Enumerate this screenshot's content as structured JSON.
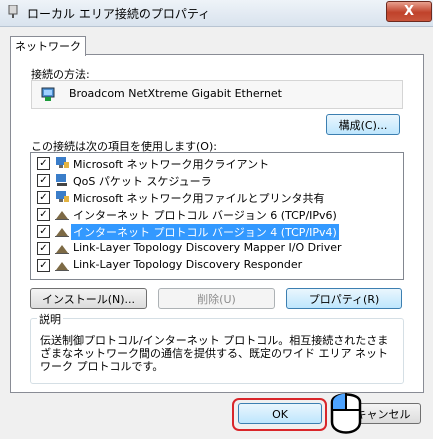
{
  "window": {
    "title": "ローカル エリア接続のプロパティ",
    "close_glyph": "X"
  },
  "tabs": [
    {
      "label": "ネットワーク"
    }
  ],
  "connect_using": {
    "label": "接続の方法:",
    "adapter": "Broadcom NetXtreme Gigabit Ethernet",
    "configure_button": "構成(C)..."
  },
  "items_section": {
    "label": "この接続は次の項目を使用します(O):",
    "items": [
      {
        "label": "Microsoft ネットワーク用クライアント",
        "checked": true,
        "icon": "network-client-icon"
      },
      {
        "label": "QoS パケット スケジューラ",
        "checked": true,
        "icon": "service-icon"
      },
      {
        "label": "Microsoft ネットワーク用ファイルとプリンタ共有",
        "checked": true,
        "icon": "network-client-icon"
      },
      {
        "label": "インターネット プロトコル バージョン 6 (TCP/IPv6)",
        "checked": true,
        "icon": "protocol-icon"
      },
      {
        "label": "インターネット プロトコル バージョン 4 (TCP/IPv4)",
        "checked": true,
        "icon": "protocol-icon",
        "selected": true
      },
      {
        "label": "Link-Layer Topology Discovery Mapper I/O Driver",
        "checked": true,
        "icon": "protocol-icon"
      },
      {
        "label": "Link-Layer Topology Discovery Responder",
        "checked": true,
        "icon": "protocol-icon"
      }
    ],
    "install_button": "インストール(N)...",
    "uninstall_button": "削除(U)",
    "properties_button": "プロパティ(R)"
  },
  "description": {
    "label": "説明",
    "text": "伝送制御プロトコル/インターネット プロトコル。相互接続されたさまざまなネットワーク間の通信を提供する、既定のワイド エリア ネットワーク プロトコルです。"
  },
  "footer": {
    "ok_button": "OK",
    "cancel_button": "キャンセル"
  },
  "colors": {
    "highlight": "#d9262a",
    "selection": "#3399ff"
  }
}
